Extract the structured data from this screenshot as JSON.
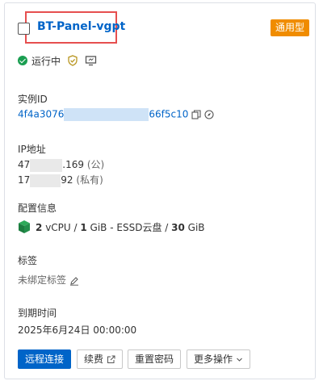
{
  "instance": {
    "name": "BT-Panel-vgpt",
    "type_badge": "通用型",
    "status": "运行中"
  },
  "instance_id": {
    "label": "实例ID",
    "prefix": "4f4a3076",
    "suffix": "66f5c10"
  },
  "ip": {
    "label": "IP地址",
    "public_prefix": "47",
    "public_suffix": ".169",
    "public_tag": "(公)",
    "private_prefix": "17",
    "private_suffix": "92",
    "private_tag": "(私有)"
  },
  "config": {
    "label": "配置信息",
    "vcpu": "2",
    "vcpu_unit": "vCPU",
    "memory": "1",
    "memory_unit": "GiB",
    "disk_type": "ESSD云盘",
    "disk_size": "30",
    "disk_unit": "GiB"
  },
  "tags": {
    "label": "标签",
    "value": "未绑定标签"
  },
  "expiry": {
    "label": "到期时间",
    "value": "2025年6月24日 00:00:00"
  },
  "actions": {
    "remote_connect": "远程连接",
    "renew": "续费",
    "reset_password": "重置密码",
    "more_actions": "更多操作"
  },
  "colors": {
    "link": "#0064c8",
    "badge": "#f08c00",
    "running": "#1a9e51",
    "highlight": "#e64f4f"
  },
  "icons": [
    "check-circle-icon",
    "shield-check-icon",
    "monitor-icon",
    "copy-icon",
    "compass-icon",
    "instance-spec-icon",
    "edit-icon",
    "external-link-icon",
    "chevron-down-icon"
  ]
}
